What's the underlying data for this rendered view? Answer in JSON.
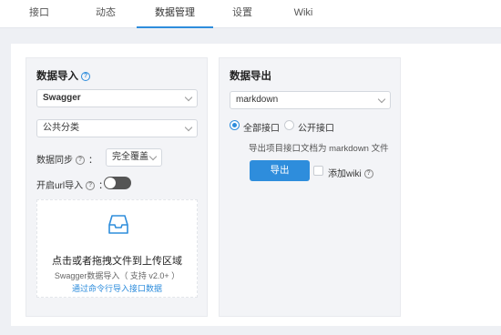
{
  "tabs": [
    {
      "label": "接口"
    },
    {
      "label": "动态"
    },
    {
      "label": "数据管理"
    },
    {
      "label": "设置"
    },
    {
      "label": "Wiki"
    }
  ],
  "active_tab": "数据管理",
  "import": {
    "title": "数据导入",
    "type_select": "Swagger",
    "category_select": "公共分类",
    "sync_label": "数据同步",
    "sync_colon": "：",
    "sync_mode": "完全覆盖",
    "url_import_label": "开启url导入",
    "url_import_colon": "：",
    "url_import_on": false,
    "dropzone_main": "点击或者拖拽文件到上传区域",
    "dropzone_sub": "Swagger数据导入（ 支持 v2.0+ ）",
    "dropzone_link": "通过命令行导入接口数据"
  },
  "export": {
    "title": "数据导出",
    "format_select": "markdown",
    "radio_all": "全部接口",
    "radio_public": "公开接口",
    "selected": "全部接口",
    "hint": "导出项目接口文档为 markdown 文件",
    "button": "导出",
    "add_wiki": "添加wiki",
    "add_wiki_checked": false
  },
  "colors": {
    "accent": "#2e8ddc",
    "toggle_off": "#555555"
  }
}
